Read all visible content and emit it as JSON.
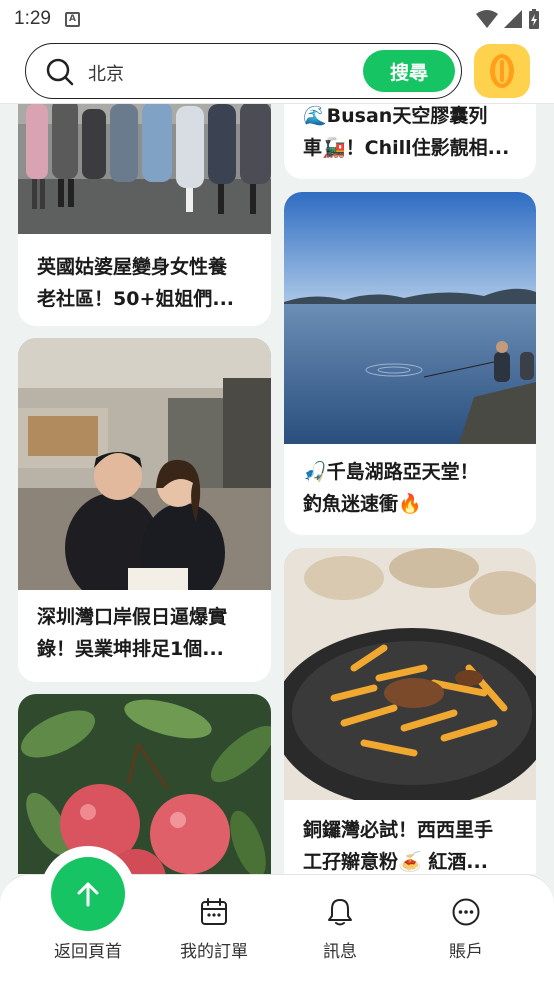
{
  "status_bar": {
    "time": "1:29"
  },
  "search": {
    "value": "北京",
    "button_label": "搜尋"
  },
  "feed": {
    "cards": [
      {
        "title_line1": "英國姑婆屋變身女性養",
        "title_line2": "老社區！50+姐姐們..."
      },
      {
        "title_line1": "深圳灣口岸假日逼爆實",
        "title_line2": "錄！吳業坤排足1個..."
      },
      {
        "title_line1": "",
        "title_line2": ""
      },
      {
        "title_line1": "🌊Busan天空膠囊列",
        "title_line2": "車🚂！Chill住影靚相..."
      },
      {
        "title_line1": "🎣千島湖路亞天堂！",
        "title_line2": "釣魚迷速衝🔥"
      },
      {
        "title_line1": "銅鑼灣必試！西西里手",
        "title_line2": "工孖辮意粉🍝 紅酒..."
      }
    ]
  },
  "bottom_nav": {
    "home": "返回頁首",
    "orders": "我的訂單",
    "messages": "訊息",
    "account": "賬戶"
  },
  "colors": {
    "accent": "#16c464",
    "coin": "#ffd24d"
  }
}
